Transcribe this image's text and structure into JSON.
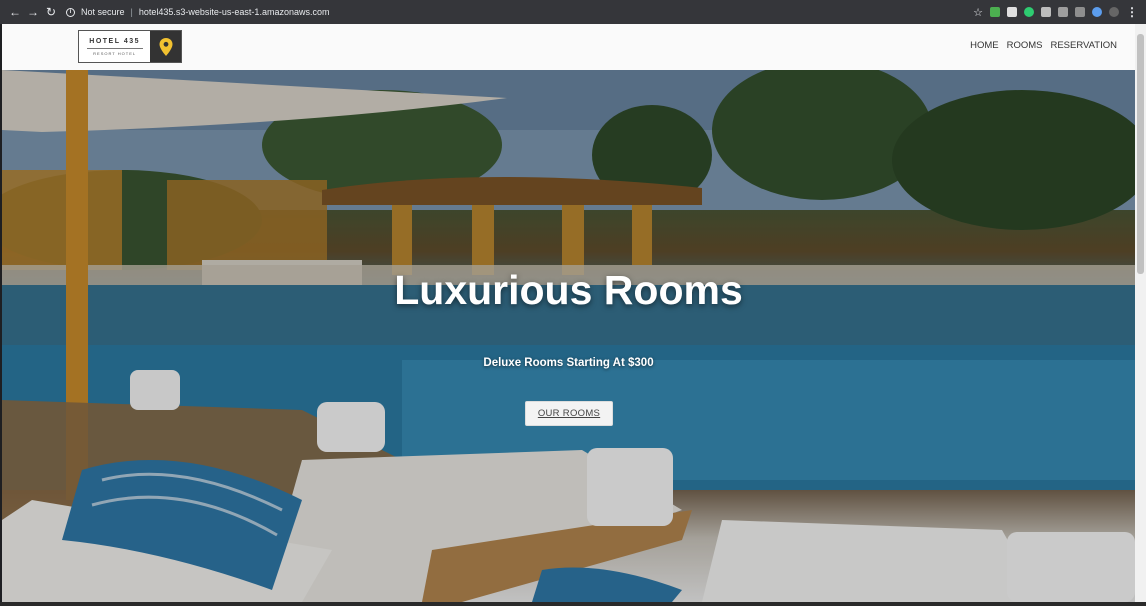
{
  "browser": {
    "security_label": "Not secure",
    "url": "hotel435.s3-website-us-east-1.amazonaws.com",
    "back_icon": "arrow-left-icon",
    "forward_icon": "arrow-right-icon",
    "reload_icon": "reload-icon"
  },
  "logo": {
    "name": "HOTEL 435",
    "subtitle": "RESORT HOTEL",
    "pin_color": "#f2c230"
  },
  "nav": {
    "items": [
      {
        "label": "HOME"
      },
      {
        "label": "ROOMS"
      },
      {
        "label": "RESERVATION"
      }
    ]
  },
  "hero": {
    "title": "Luxurious Rooms",
    "subtitle": "Deluxe Rooms Starting At $300",
    "button_label": "OUR ROOMS"
  },
  "colors": {
    "chrome_bg": "#35363a",
    "header_bg": "#fafafa",
    "pool_blue": "#2f7ba3"
  }
}
